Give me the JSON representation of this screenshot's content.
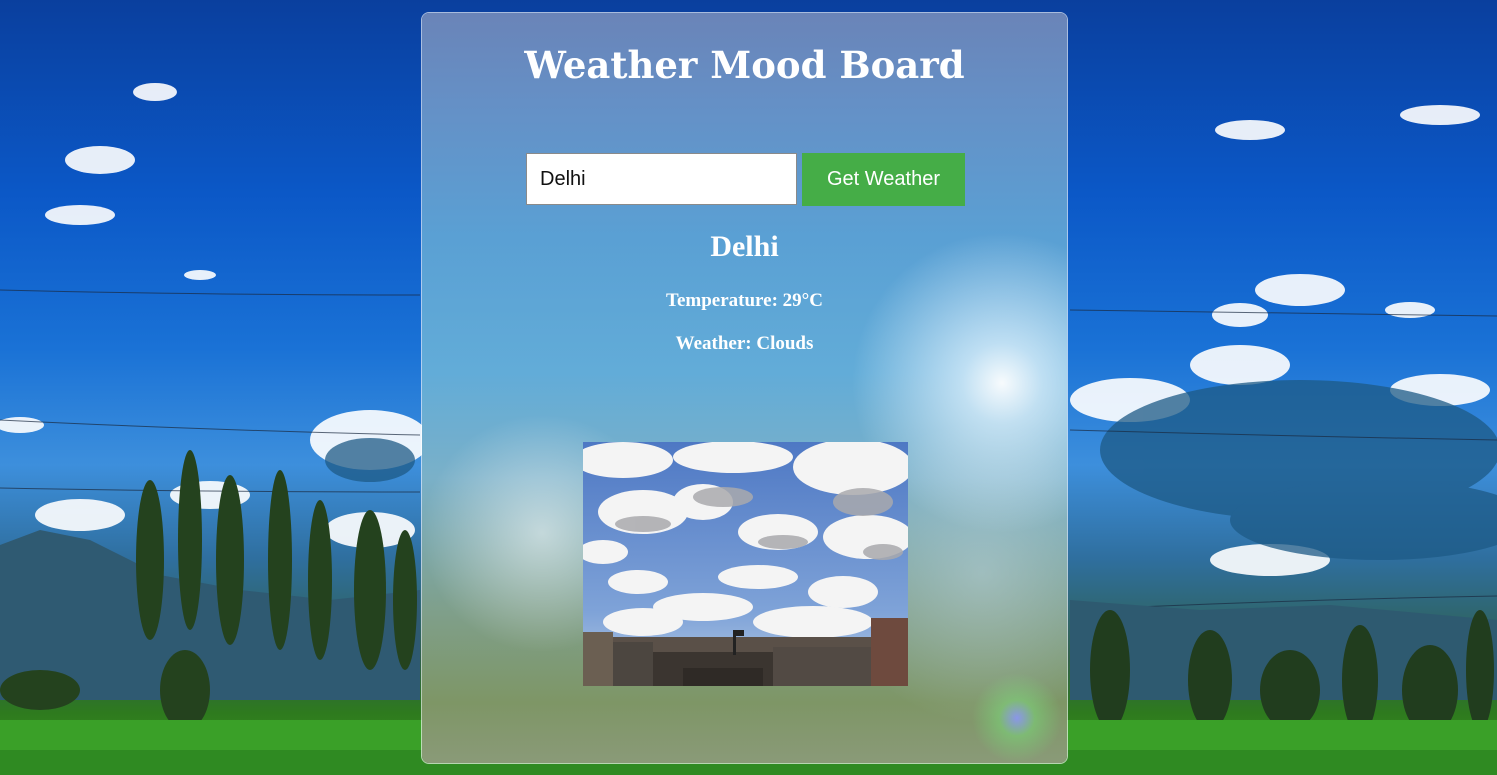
{
  "app": {
    "title": "Weather Mood Board"
  },
  "search": {
    "value": "Delhi",
    "button_label": "Get Weather"
  },
  "result": {
    "city": "Delhi",
    "temperature_line": "Temperature: 29°C",
    "weather_line": "Weather: Clouds"
  },
  "mood_image": {
    "icon": "cloudy-sky-photo"
  },
  "colors": {
    "button": "#45ad47",
    "text": "#ffffff"
  }
}
